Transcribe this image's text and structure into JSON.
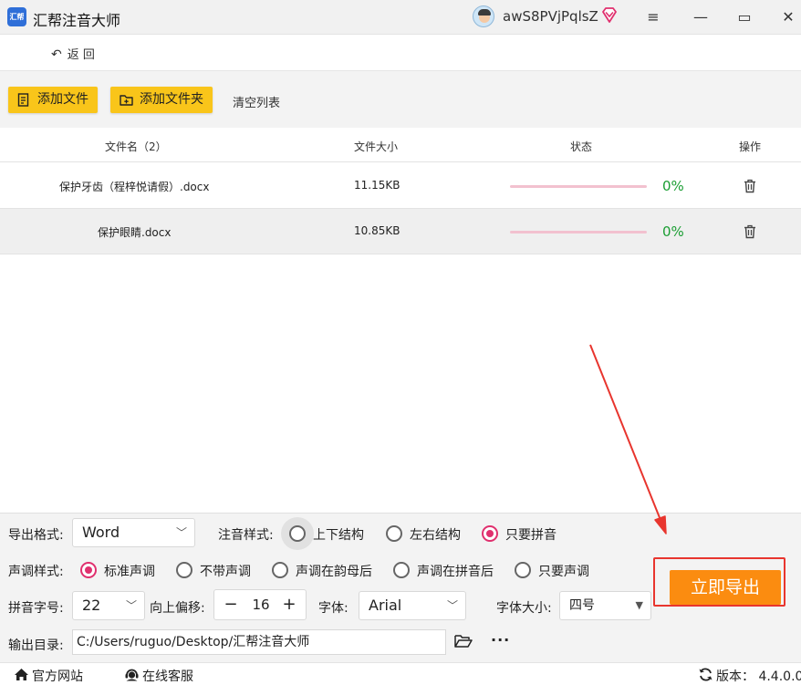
{
  "app": {
    "title": "汇帮注音大师",
    "logo_text": "汇帮"
  },
  "user": {
    "name": "awS8PVjPqlsZ"
  },
  "window_controls": {
    "menu": "≡",
    "minimize": "—",
    "maximize": "▭",
    "close": "✕"
  },
  "nav": {
    "back_label": "返 回"
  },
  "toolbar": {
    "add_file": "添加文件",
    "add_folder": "添加文件夹",
    "clear_list": "清空列表"
  },
  "table": {
    "headers": {
      "name": "文件名（2）",
      "size": "文件大小",
      "status": "状态",
      "action": "操作"
    },
    "rows": [
      {
        "name": "保护牙齿（程梓悦请假）.docx",
        "size": "11.15KB",
        "progress": "0%"
      },
      {
        "name": "保护眼睛.docx",
        "size": "10.85KB",
        "progress": "0%"
      }
    ]
  },
  "settings": {
    "export_format": {
      "label": "导出格式:",
      "value": "Word"
    },
    "annotation_style": {
      "label": "注音样式:",
      "options": [
        "上下结构",
        "左右结构",
        "只要拼音"
      ],
      "selected": "只要拼音"
    },
    "tone_style": {
      "label": "声调样式:",
      "options": [
        "标准声调",
        "不带声调",
        "声调在韵母后",
        "声调在拼音后",
        "只要声调"
      ],
      "selected": "标准声调"
    },
    "pinyin_size": {
      "label": "拼音字号:",
      "value": "22"
    },
    "offset": {
      "label": "向上偏移:",
      "value": "16",
      "minus": "−",
      "plus": "+"
    },
    "font": {
      "label": "字体:",
      "value": "Arial"
    },
    "font_size": {
      "label": "字体大小:",
      "value": "四号"
    },
    "output_dir": {
      "label": "输出目录:",
      "value": "C:/Users/ruguo/Desktop/汇帮注音大师",
      "more": "···"
    },
    "export_button": "立即导出"
  },
  "footer": {
    "website": "官方网站",
    "support": "在线客服",
    "version": "版本： 4.4.0.0"
  },
  "colors": {
    "accent_yellow": "#f9c51a",
    "export_orange": "#fb8c10",
    "radio_pink": "#e0306e",
    "progress_green": "#1b9e33",
    "annotation_red": "#e8352e"
  }
}
